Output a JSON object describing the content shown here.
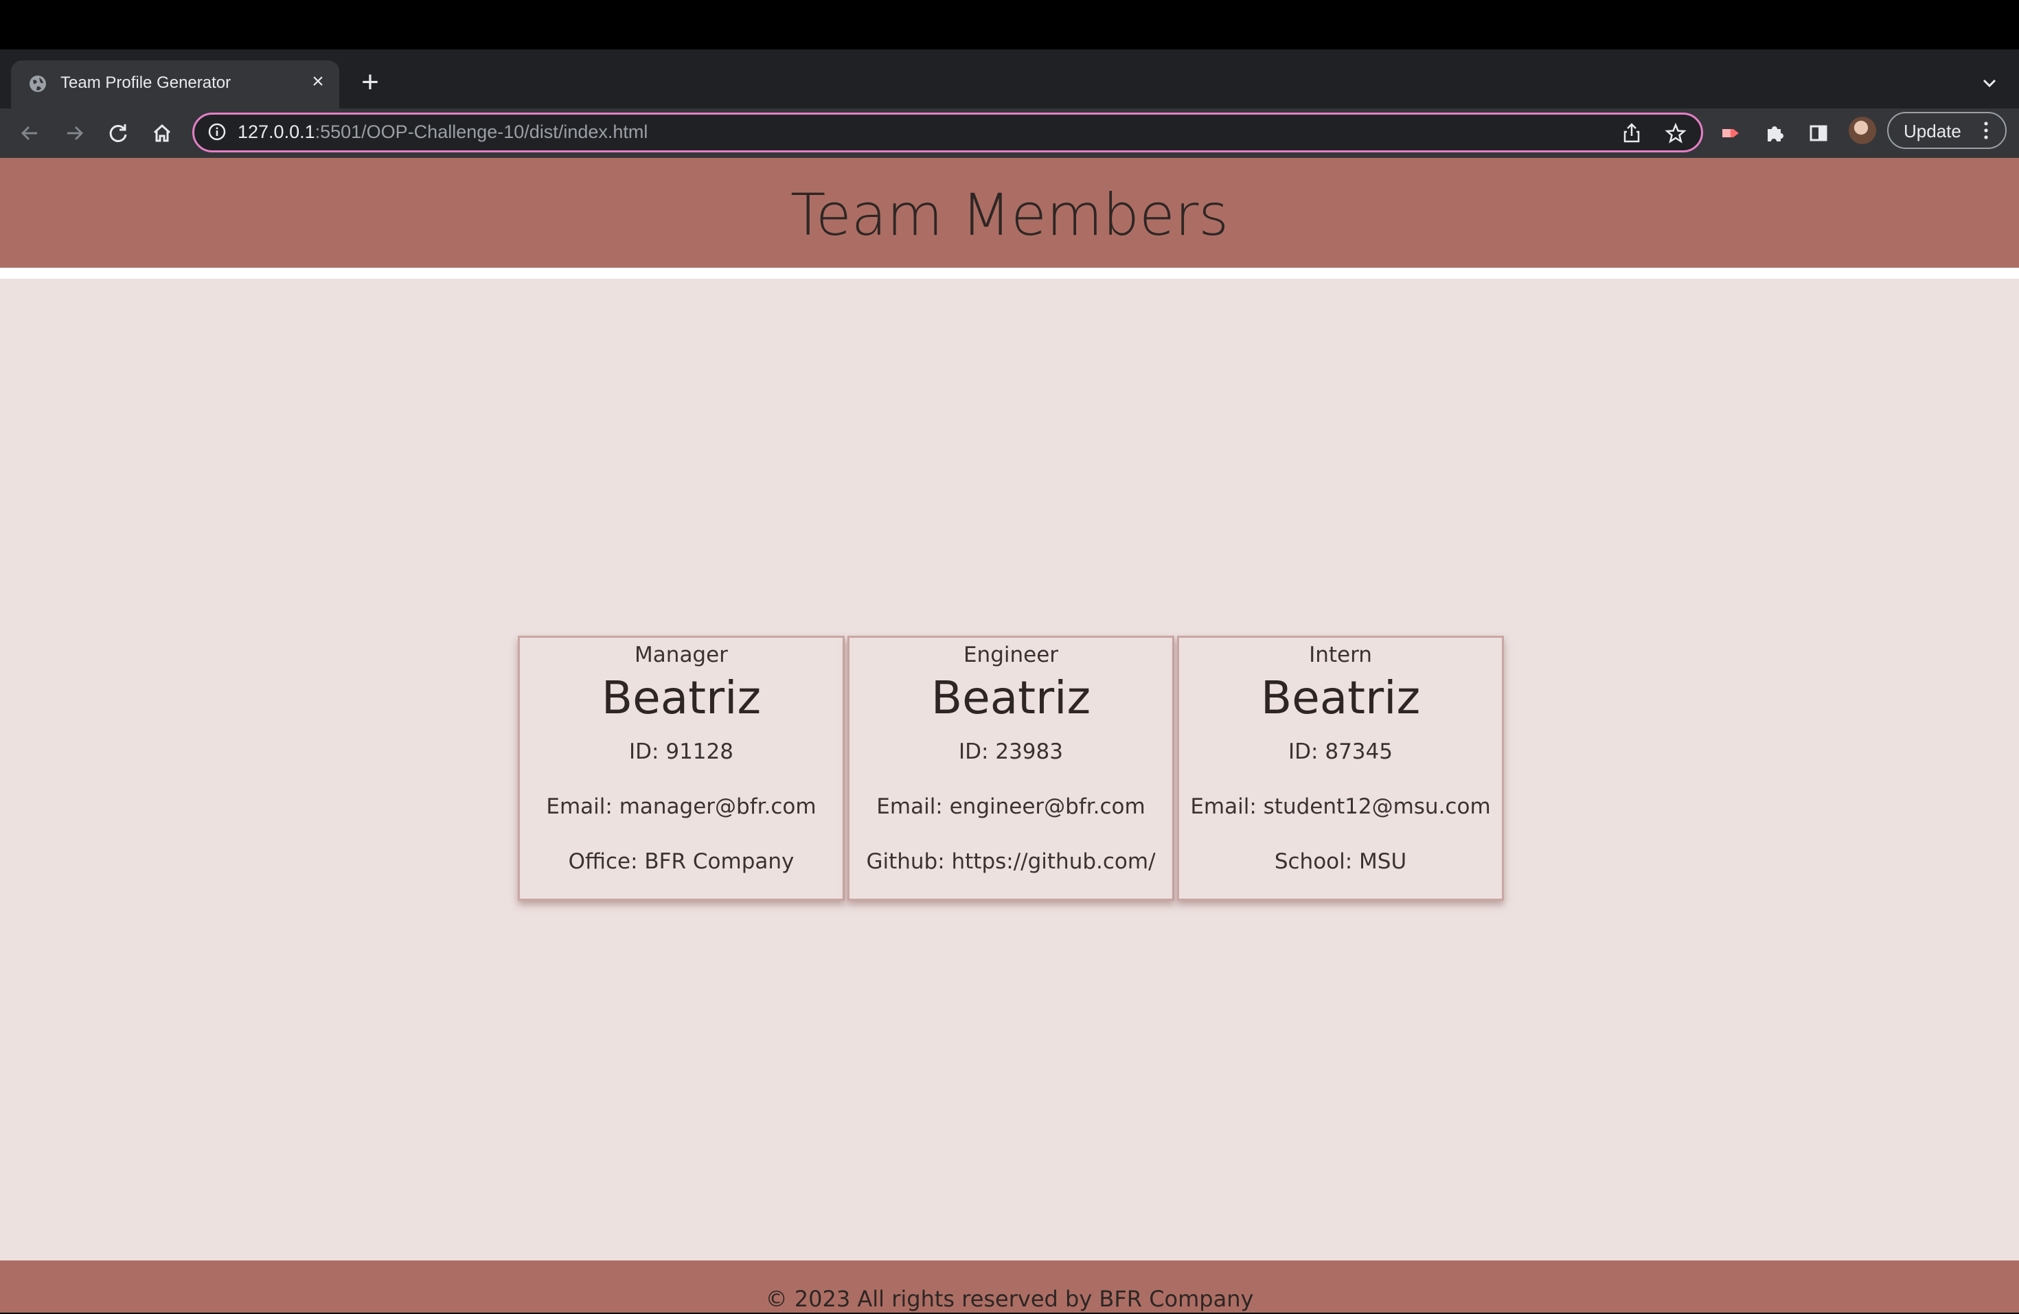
{
  "browser": {
    "tab_title": "Team Profile Generator",
    "tab_close_icon": "×",
    "new_tab_icon": "+",
    "tab_list_icon": "⌄",
    "url_host": "127.0.0.1",
    "url_rest": ":5501/OOP-Challenge-10/dist/index.html",
    "update_label": "Update",
    "accent_color": "#e57fc6"
  },
  "header": {
    "title": "Team Members",
    "color": "#ac6e64"
  },
  "cards": [
    {
      "role": "Manager",
      "name": "Beatriz",
      "id": "ID: 91128",
      "email": "Email: manager@bfr.com",
      "extra": "Office: BFR Company"
    },
    {
      "role": "Engineer",
      "name": "Beatriz",
      "id": "ID: 23983",
      "email": "Email: engineer@bfr.com",
      "extra": "Github: https://github.com/"
    },
    {
      "role": "Intern",
      "name": "Beatriz",
      "id": "ID: 87345",
      "email": "Email: student12@msu.com",
      "extra": "School: MSU"
    }
  ],
  "footer": {
    "text": "© 2023 All rights reserved by BFR Company"
  }
}
